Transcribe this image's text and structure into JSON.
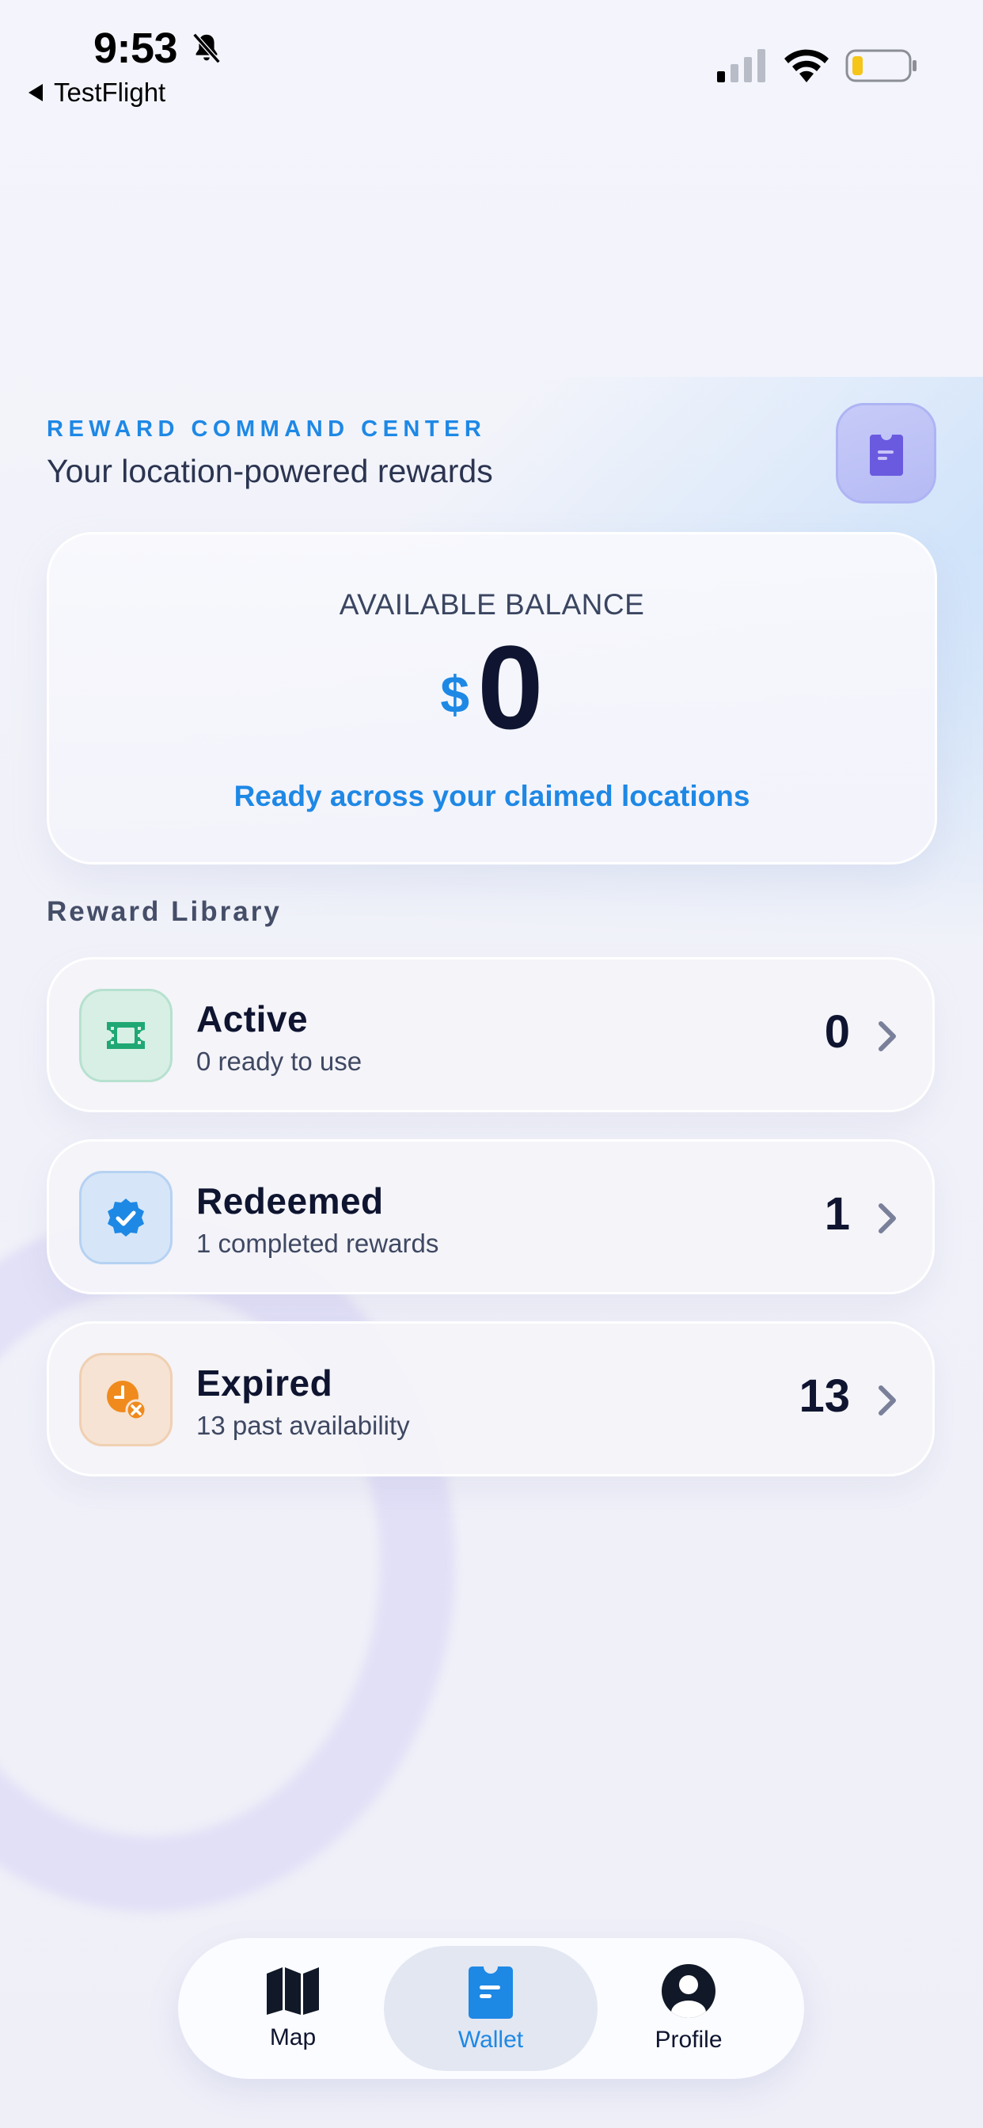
{
  "status_bar": {
    "time": "9:53",
    "back_app": "TestFlight",
    "battery_color": "#f5c518"
  },
  "header": {
    "eyebrow": "REWARD COMMAND CENTER",
    "title": "Your location-powered rewards",
    "badge_icon": "wallet-card-icon"
  },
  "balance": {
    "label": "AVAILABLE BALANCE",
    "currency": "$",
    "amount": "0",
    "caption": "Ready across your claimed locations"
  },
  "library": {
    "title": "Reward Library",
    "items": [
      {
        "name": "Active",
        "subtitle": "0 ready to use",
        "count": "0",
        "icon": "ticket-icon",
        "color": "#1fa774"
      },
      {
        "name": "Redeemed",
        "subtitle": "1 completed rewards",
        "count": "1",
        "icon": "verified-badge-icon",
        "color": "#1e88e5"
      },
      {
        "name": "Expired",
        "subtitle": "13 past availability",
        "count": "13",
        "icon": "clock-expired-icon",
        "color": "#f08a1c"
      }
    ]
  },
  "tab_bar": {
    "tabs": [
      {
        "label": "Map",
        "icon": "map-icon",
        "active": false
      },
      {
        "label": "Wallet",
        "icon": "wallet-icon",
        "active": true
      },
      {
        "label": "Profile",
        "icon": "profile-icon",
        "active": false
      }
    ]
  },
  "colors": {
    "accent": "#1e88e5",
    "text_primary": "#0f1530",
    "text_secondary": "#3f4862",
    "badge_purple": "#6a5ae0"
  }
}
